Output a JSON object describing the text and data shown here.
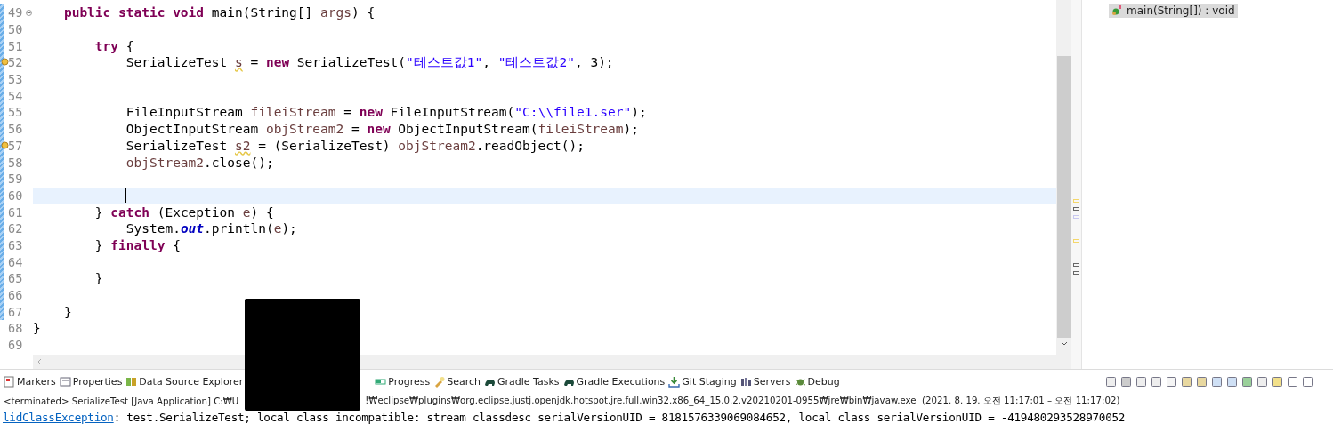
{
  "editor": {
    "lines": [
      {
        "number": "49",
        "fold": true,
        "tokens": [
          {
            "kind": "kw",
            "text": "    public static void"
          },
          {
            "kind": "text",
            "text": " main(String[] "
          },
          {
            "kind": "var",
            "text": "args"
          },
          {
            "kind": "text",
            "text": ") {"
          }
        ]
      },
      {
        "number": "50"
      },
      {
        "number": "51",
        "tokens": [
          {
            "kind": "kw",
            "text": "        try"
          },
          {
            "kind": "text",
            "text": " {"
          }
        ]
      },
      {
        "number": "52",
        "warning": true,
        "tokens": [
          {
            "kind": "text",
            "text": "            SerializeTest "
          },
          {
            "kind": "warnvar",
            "text": "s"
          },
          {
            "kind": "text",
            "text": " = "
          },
          {
            "kind": "kw",
            "text": "new"
          },
          {
            "kind": "text",
            "text": " SerializeTest("
          },
          {
            "kind": "str",
            "text": "\"테스트값1\""
          },
          {
            "kind": "text",
            "text": ", "
          },
          {
            "kind": "str",
            "text": "\"테스트값2\""
          },
          {
            "kind": "text",
            "text": ", 3);"
          }
        ]
      },
      {
        "number": "53"
      },
      {
        "number": "54"
      },
      {
        "number": "55",
        "tokens": [
          {
            "kind": "text",
            "text": "            FileInputStream "
          },
          {
            "kind": "var",
            "text": "fileiStream"
          },
          {
            "kind": "text",
            "text": " = "
          },
          {
            "kind": "kw",
            "text": "new"
          },
          {
            "kind": "text",
            "text": " FileInputStream("
          },
          {
            "kind": "str",
            "text": "\"C:\\\\file1.ser\""
          },
          {
            "kind": "text",
            "text": ");"
          }
        ]
      },
      {
        "number": "56",
        "tokens": [
          {
            "kind": "text",
            "text": "            ObjectInputStream "
          },
          {
            "kind": "var",
            "text": "objStream2"
          },
          {
            "kind": "text",
            "text": " = "
          },
          {
            "kind": "kw",
            "text": "new"
          },
          {
            "kind": "text",
            "text": " ObjectInputStream("
          },
          {
            "kind": "var",
            "text": "fileiStream"
          },
          {
            "kind": "text",
            "text": ");"
          }
        ]
      },
      {
        "number": "57",
        "warning": true,
        "tokens": [
          {
            "kind": "text",
            "text": "            SerializeTest "
          },
          {
            "kind": "warnvar",
            "text": "s2"
          },
          {
            "kind": "text",
            "text": " = (SerializeTest) "
          },
          {
            "kind": "var",
            "text": "objStream2"
          },
          {
            "kind": "text",
            "text": ".readObject();"
          }
        ]
      },
      {
        "number": "58",
        "tokens": [
          {
            "kind": "var",
            "text": "            objStream2"
          },
          {
            "kind": "text",
            "text": ".close();"
          }
        ]
      },
      {
        "number": "59"
      },
      {
        "number": "60",
        "current": true
      },
      {
        "number": "61",
        "tokens": [
          {
            "kind": "text",
            "text": "        } "
          },
          {
            "kind": "kw",
            "text": "catch"
          },
          {
            "kind": "text",
            "text": " (Exception "
          },
          {
            "kind": "var",
            "text": "e"
          },
          {
            "kind": "text",
            "text": ") {"
          }
        ]
      },
      {
        "number": "62",
        "tokens": [
          {
            "kind": "text",
            "text": "            System."
          },
          {
            "kind": "field",
            "text": "out"
          },
          {
            "kind": "text",
            "text": ".println("
          },
          {
            "kind": "var",
            "text": "e"
          },
          {
            "kind": "text",
            "text": ");"
          }
        ]
      },
      {
        "number": "63",
        "tokens": [
          {
            "kind": "text",
            "text": "        } "
          },
          {
            "kind": "kw",
            "text": "finally"
          },
          {
            "kind": "text",
            "text": " {"
          }
        ]
      },
      {
        "number": "64"
      },
      {
        "number": "65",
        "tokens": [
          {
            "kind": "text",
            "text": "        }"
          }
        ]
      },
      {
        "number": "66"
      },
      {
        "number": "67",
        "tokens": [
          {
            "kind": "text",
            "text": "    }"
          }
        ]
      },
      {
        "number": "68",
        "tokens": [
          {
            "kind": "text",
            "text": "}"
          }
        ]
      },
      {
        "number": "69"
      }
    ]
  },
  "outline": {
    "items": [
      {
        "label": "main(String[]) : void",
        "selected": true
      }
    ]
  },
  "bottom_tabs": [
    {
      "label": "Markers",
      "kind": "markers"
    },
    {
      "label": "Properties",
      "kind": "properties"
    },
    {
      "label": "Data Source Explorer",
      "kind": "datasource"
    },
    {
      "label": "Progress",
      "kind": "progress"
    },
    {
      "label": "Search",
      "kind": "search"
    },
    {
      "label": "Gradle Tasks",
      "kind": "gradle"
    },
    {
      "label": "Gradle Executions",
      "kind": "gradle"
    },
    {
      "label": "Git Staging",
      "kind": "git"
    },
    {
      "label": "Servers",
      "kind": "servers"
    },
    {
      "label": "Debug",
      "kind": "debug"
    }
  ],
  "console": {
    "header_start": "<terminated> SerializeTest [Java Application] C:₩U",
    "header_end": "!₩eclipse₩plugins₩org.eclipse.justj.openjdk.hotspot.jre.full.win32.x86_64_15.0.2.v20210201-0955₩jre₩bin₩javaw.exe  (2021. 8. 19. 오전 11:17:01 – 오전 11:17:02)",
    "link": "lidClassException",
    "output": ": test.SerializeTest; local class incompatible: stream classdesc serialVersionUID = 8181576339069084652, local class serialVersionUID = -419480293528970052"
  }
}
